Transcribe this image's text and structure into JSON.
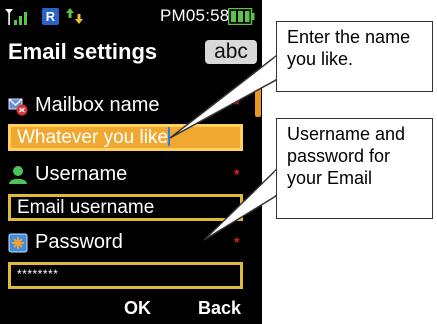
{
  "status": {
    "time": "PM05:58",
    "roaming_badge": "R"
  },
  "screen": {
    "title": "Email settings",
    "input_mode": "abc"
  },
  "fields": [
    {
      "label": "Mailbox name",
      "value": "Whatever you like",
      "required_mark": "*",
      "icon": "mailbox-icon"
    },
    {
      "label": "Username",
      "value": "Email username",
      "required_mark": "*",
      "icon": "user-icon"
    },
    {
      "label": "Password",
      "value": "********",
      "required_mark": "*",
      "icon": "key-icon"
    }
  ],
  "softkeys": {
    "left": "OK",
    "right": "Back"
  },
  "callouts": {
    "mailbox": "Enter the name you like.",
    "credentials": "Username and password for your Email"
  },
  "colors": {
    "accent": "#e0bb36",
    "active_field": "#f0a830",
    "required": "#e02020",
    "background": "#000000"
  }
}
